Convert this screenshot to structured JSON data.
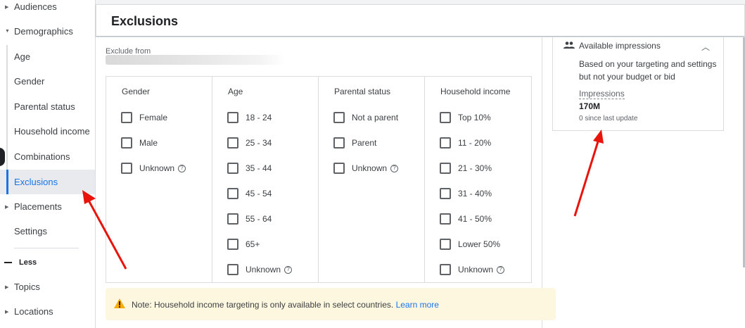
{
  "sidebar": {
    "items": [
      {
        "label": "Audiences",
        "arrow": true
      },
      {
        "label": "Demographics",
        "arrow": true,
        "expanded": true
      },
      {
        "label": "Age",
        "sub": true
      },
      {
        "label": "Gender",
        "sub": true
      },
      {
        "label": "Parental status",
        "sub": true
      },
      {
        "label": "Household income",
        "sub": true
      },
      {
        "label": "Combinations",
        "sub": true
      },
      {
        "label": "Exclusions",
        "sub": true,
        "active": true
      },
      {
        "label": "Placements",
        "arrow": true
      },
      {
        "label": "Settings"
      }
    ],
    "less_label": "Less",
    "more_items": [
      {
        "label": "Topics"
      },
      {
        "label": "Locations"
      }
    ]
  },
  "header": {
    "title": "Exclusions"
  },
  "exclude": {
    "label": "Exclude from"
  },
  "columns": [
    {
      "title": "Gender",
      "options": [
        "Female",
        "Male",
        "Unknown"
      ]
    },
    {
      "title": "Age",
      "options": [
        "18 - 24",
        "25 - 34",
        "35 - 44",
        "45 - 54",
        "55 - 64",
        "65+",
        "Unknown"
      ]
    },
    {
      "title": "Parental status",
      "options": [
        "Not a parent",
        "Parent",
        "Unknown"
      ]
    },
    {
      "title": "Household income",
      "options": [
        "Top 10%",
        "11 - 20%",
        "21 - 30%",
        "31 - 40%",
        "41 - 50%",
        "Lower 50%",
        "Unknown"
      ]
    }
  ],
  "note": {
    "text": "Note: Household income targeting is only available in select countries.",
    "link": "Learn more"
  },
  "impressions_card": {
    "title": "Available impressions",
    "description": "Based on your targeting and settings but not your budget or bid",
    "label": "Impressions",
    "value": "170M",
    "since": "0 since last update"
  },
  "colors": {
    "accent": "#1a73e8",
    "annotation_arrow": "#e8140c",
    "note_bg": "#fef7e0",
    "warning": "#f9ab00"
  }
}
